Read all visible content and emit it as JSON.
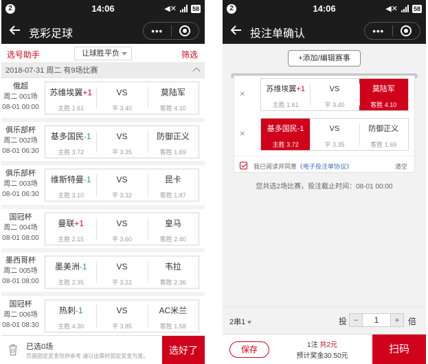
{
  "status_bar": {
    "badge": "2",
    "time": "14:06",
    "network": "4G",
    "battery": "58"
  },
  "left": {
    "nav_title": "竞彩足球",
    "capsule_dots": "•••",
    "helper_label": "选号助手",
    "play_dropdown": "让球胜平负",
    "filter_label": "筛选",
    "date_header": "2018-07-31 周二 有9场比赛",
    "matches": [
      {
        "league": "俄超",
        "num": "周二 001场",
        "time": "08-01 00:00",
        "home": "苏维埃翼",
        "handicap": "+1",
        "hc_color": "up",
        "home_odd": "主胜 1.61",
        "vs": "VS",
        "draw_odd": "平 3.40",
        "away": "莫陆军",
        "away_odd": "客胜 4.10"
      },
      {
        "league": "俱乐部杯",
        "num": "周二 002场",
        "time": "08-01 06:30",
        "home": "基多国民",
        "handicap": "-1",
        "hc_color": "down",
        "home_odd": "主胜 3.72",
        "vs": "VS",
        "draw_odd": "平 3.35",
        "away": "防御正义",
        "away_odd": "客胜 1.69"
      },
      {
        "league": "俱乐部杯",
        "num": "周二 003场",
        "time": "08-01 06:30",
        "home": "维斯特曼",
        "handicap": "-1",
        "hc_color": "down",
        "home_odd": "主胜 3.10",
        "vs": "VS",
        "draw_odd": "平 3.32",
        "away": "昆卡",
        "away_odd": "客胜 1.87"
      },
      {
        "league": "国冠杯",
        "num": "周二 004场",
        "time": "08-01 08:00",
        "home": "曼联",
        "handicap": "+1",
        "hc_color": "up",
        "home_odd": "主胜 2.15",
        "vs": "VS",
        "draw_odd": "平 3.60",
        "away": "皇马",
        "away_odd": "客胜 2.40"
      },
      {
        "league": "墨西哥杯",
        "num": "周二 005场",
        "time": "08-01 08:00",
        "home": "墨美洲",
        "handicap": "-1",
        "hc_color": "down",
        "home_odd": "主胜 2.35",
        "vs": "VS",
        "draw_odd": "平 3.22",
        "away": "韦拉",
        "away_odd": "客胜 2.36"
      },
      {
        "league": "国冠杯",
        "num": "周二 006场",
        "time": "08-01 08:30",
        "home": "热刺",
        "handicap": "-1",
        "hc_color": "down",
        "home_odd": "主胜 4.30",
        "vs": "VS",
        "draw_odd": "平 3.85",
        "away": "AC米兰",
        "away_odd": "客胜 1.58"
      }
    ],
    "selected_count": "已选0场",
    "disclaimer": "页面固定奖金仅供参考,请以出票时固定奖金为准。",
    "done_label": "选好了"
  },
  "right": {
    "nav_title": "投注单确认",
    "capsule_dots": "•••",
    "add_edit_label": "+添加/编辑赛事",
    "bets": [
      {
        "remove": "×",
        "home": "苏维埃翼",
        "handicap": "+1",
        "hc_color": "up",
        "home_odd": "主胜 1.61",
        "vs": "VS",
        "draw_odd": "平 3.40",
        "away": "莫陆军",
        "away_odd": "客胜 4.10",
        "selected": "away"
      },
      {
        "remove": "×",
        "home": "基多国民",
        "handicap": "-1",
        "hc_color": "down",
        "home_odd": "主胜 3.72",
        "vs": "VS",
        "draw_odd": "平 3.35",
        "away": "防御正义",
        "away_odd": "客胜 1.69",
        "selected": "home"
      }
    ],
    "agree_prefix": "我已阅读并同意",
    "agree_link": "《电子投注单协议》",
    "clear_label": "清空",
    "summary": "您共选2场比赛，投注截止时间：08-01 00:00",
    "pass_type": "2串1",
    "stake_prefix": "投",
    "stake_minus": "−",
    "stake_value": "1",
    "stake_plus": "+",
    "stake_suffix": "倍",
    "save_label": "保存",
    "cost_prefix": "1注 ",
    "cost_amount": "共2元",
    "prize": "预计奖金30.50元",
    "scan_label": "扫码"
  },
  "colors": {
    "accent_red": "#d0021b",
    "handicap_green": "#2e9e3e",
    "nav_bg": "#1c1c1c"
  }
}
